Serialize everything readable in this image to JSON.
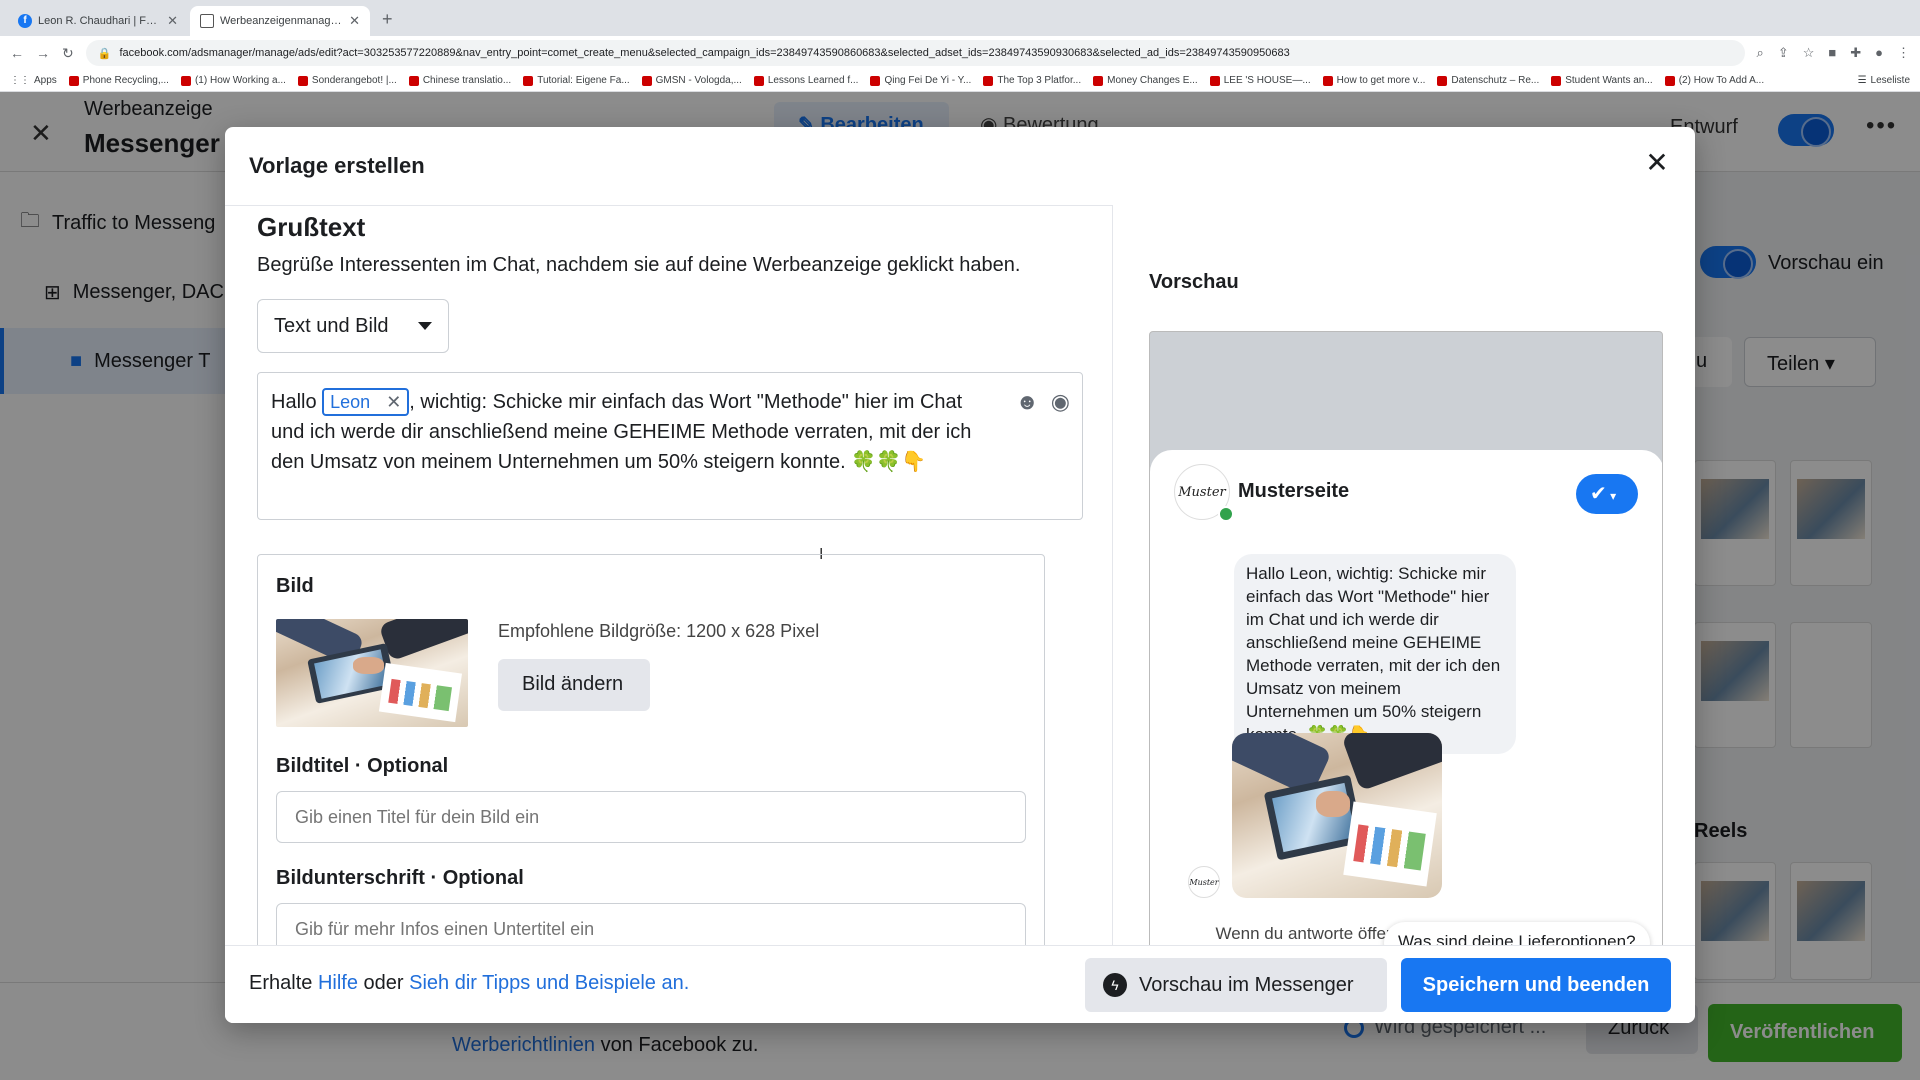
{
  "browser": {
    "tabs": [
      {
        "title": "Leon R. Chaudhari | Facebook",
        "active": false
      },
      {
        "title": "Werbeanzeigenmanager - Werb",
        "active": true
      }
    ],
    "new_tab": "+",
    "url": "facebook.com/adsmanager/manage/ads/edit?act=303253577220889&nav_entry_point=comet_create_menu&selected_campaign_ids=23849743590860683&selected_adset_ids=23849743590930683&selected_ad_ids=23849743590950683",
    "bookmarks": [
      "Apps",
      "Phone Recycling,...",
      "(1) How Working a...",
      "Sonderangebot! |...",
      "Chinese translatio...",
      "Tutorial: Eigene Fa...",
      "GMSN - Vologda,...",
      "Lessons Learned f...",
      "Qing Fei De Yi - Y...",
      "The Top 3 Platfor...",
      "Money Changes E...",
      "LEE 'S HOUSE—...",
      "How to get more v...",
      "Datenschutz – Re...",
      "Student Wants an...",
      "(2) How To Add A..."
    ],
    "reading_list": "Leseliste"
  },
  "background": {
    "title_small": "Werbeanzeige",
    "title_large": "Messenger",
    "edit_tab": "Bearbeiten",
    "review_tab": "Bewertung",
    "status": "Entwurf",
    "sidebar": [
      {
        "label": "Traffic to Messeng",
        "icon": "folder-icon"
      },
      {
        "label": "Messenger, DAC",
        "icon": "grid-icon"
      },
      {
        "label": "Messenger T",
        "icon": "ad-icon"
      }
    ],
    "preview_toggle": "Vorschau ein",
    "share": "Teilen",
    "partial_button": "u",
    "reels": "Reels",
    "policy_link": "Werberichtlinien",
    "policy_suffix": "von Facebook zu.",
    "saving": "Wird gespeichert ...",
    "back": "Zurück",
    "publish": "Veröffentlichen"
  },
  "modal": {
    "title": "Vorlage erstellen",
    "section_title": "Grußtext",
    "section_desc": "Begrüße Interessenten im Chat, nachdem sie auf deine Werbeanzeige geklickt haben.",
    "format_select": "Text und Bild",
    "greeting": {
      "prefix": "Hallo",
      "name_token": "Leon",
      "text": ", wichtig: Schicke mir einfach das Wort \"Methode\" hier im Chat und ich werde dir anschließend meine GEHEIME Methode verraten, mit der ich den Umsatz von meinem Unternehmen um 50% steigern konnte. 🍀🍀👇"
    },
    "image": {
      "label": "Bild",
      "recommended": "Empfohlene Bildgröße: 1200 x 628 Pixel",
      "change_button": "Bild ändern"
    },
    "image_title": {
      "label": "Bildtitel",
      "optional": "Optional",
      "placeholder": "Gib einen Titel für dein Bild ein"
    },
    "image_caption": {
      "label": "Bildunterschrift",
      "optional": "Optional",
      "placeholder": "Gib für mehr Infos einen Untertitel ein"
    },
    "preview": {
      "label": "Vorschau",
      "page_name": "Musterseite",
      "avatar_text": "Muster",
      "message": "Hallo Leon, wichtig: Schicke mir einfach das Wort \"Methode\" hier im Chat und ich werde dir anschließend meine GEHEIME Methode verraten, mit der ich den Umsatz von meinem Unternehmen um 50% steigern konnte. 🍀🍀👇",
      "info_text": "Wenn du antworte öffentlichen Informa",
      "quick_reply": "Was sind deine Lieferoptionen?"
    },
    "footer": {
      "prefix": "Erhalte",
      "help_link": "Hilfe",
      "middle": "oder",
      "tips_link": "Sieh dir Tipps und Beispiele an.",
      "preview_button": "Vorschau im Messenger",
      "save_button": "Speichern und beenden"
    }
  }
}
